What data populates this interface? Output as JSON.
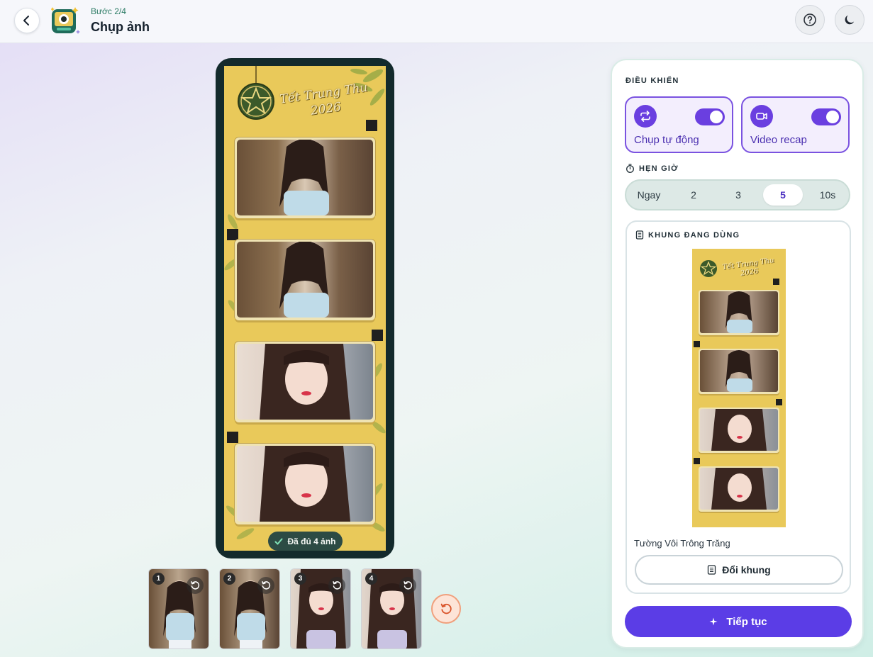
{
  "header": {
    "step": "Bước 2/4",
    "title": "Chụp ảnh"
  },
  "strip": {
    "title_line1": "Tết Trung Thu",
    "title_line2": "2026",
    "done_label": "Đã đủ 4 ảnh"
  },
  "thumbnails": [
    {
      "num": "1",
      "style": "cafe"
    },
    {
      "num": "2",
      "style": "cafe"
    },
    {
      "num": "3",
      "style": "close"
    },
    {
      "num": "4",
      "style": "close"
    }
  ],
  "controls": {
    "section_label": "ĐIỀU KHIỂN",
    "auto_capture": {
      "label": "Chụp tự động",
      "on": true
    },
    "video_recap": {
      "label": "Video recap",
      "on": true
    },
    "timer_label": "HẸN GIỜ",
    "timer_options": [
      "Ngay",
      "2",
      "3",
      "5",
      "10s"
    ],
    "timer_selected": "5"
  },
  "frame": {
    "section_label": "KHUNG ĐANG DÙNG",
    "name": "Tường Vôi Trông Trăng",
    "change_label": "Đổi khung"
  },
  "continue_label": "Tiếp tục",
  "colors": {
    "accent": "#5b3de6",
    "strip_yellow": "#e9c95a",
    "strip_border": "#132a2c"
  }
}
